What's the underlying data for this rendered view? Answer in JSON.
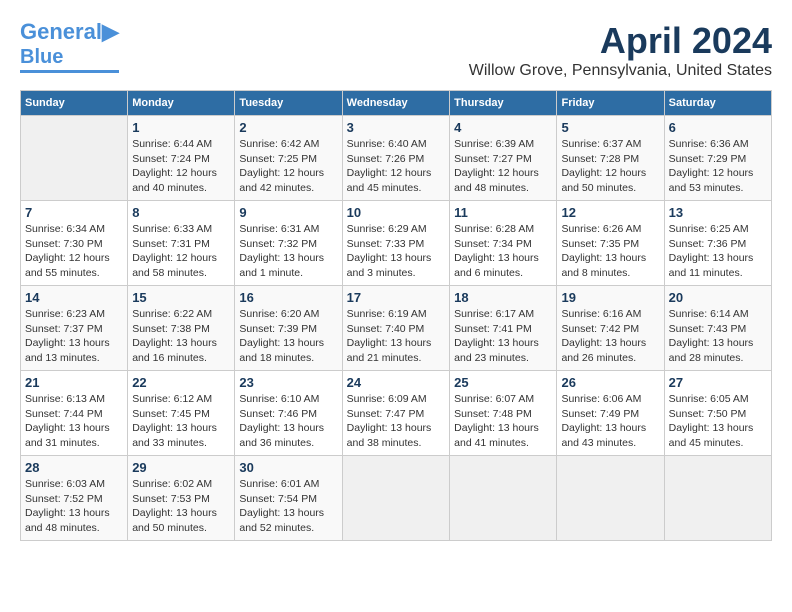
{
  "header": {
    "logo_line1": "General",
    "logo_line2": "Blue",
    "month_title": "April 2024",
    "location": "Willow Grove, Pennsylvania, United States"
  },
  "calendar": {
    "weekdays": [
      "Sunday",
      "Monday",
      "Tuesday",
      "Wednesday",
      "Thursday",
      "Friday",
      "Saturday"
    ],
    "weeks": [
      [
        {
          "day": "",
          "info": ""
        },
        {
          "day": "1",
          "info": "Sunrise: 6:44 AM\nSunset: 7:24 PM\nDaylight: 12 hours\nand 40 minutes."
        },
        {
          "day": "2",
          "info": "Sunrise: 6:42 AM\nSunset: 7:25 PM\nDaylight: 12 hours\nand 42 minutes."
        },
        {
          "day": "3",
          "info": "Sunrise: 6:40 AM\nSunset: 7:26 PM\nDaylight: 12 hours\nand 45 minutes."
        },
        {
          "day": "4",
          "info": "Sunrise: 6:39 AM\nSunset: 7:27 PM\nDaylight: 12 hours\nand 48 minutes."
        },
        {
          "day": "5",
          "info": "Sunrise: 6:37 AM\nSunset: 7:28 PM\nDaylight: 12 hours\nand 50 minutes."
        },
        {
          "day": "6",
          "info": "Sunrise: 6:36 AM\nSunset: 7:29 PM\nDaylight: 12 hours\nand 53 minutes."
        }
      ],
      [
        {
          "day": "7",
          "info": "Sunrise: 6:34 AM\nSunset: 7:30 PM\nDaylight: 12 hours\nand 55 minutes."
        },
        {
          "day": "8",
          "info": "Sunrise: 6:33 AM\nSunset: 7:31 PM\nDaylight: 12 hours\nand 58 minutes."
        },
        {
          "day": "9",
          "info": "Sunrise: 6:31 AM\nSunset: 7:32 PM\nDaylight: 13 hours\nand 1 minute."
        },
        {
          "day": "10",
          "info": "Sunrise: 6:29 AM\nSunset: 7:33 PM\nDaylight: 13 hours\nand 3 minutes."
        },
        {
          "day": "11",
          "info": "Sunrise: 6:28 AM\nSunset: 7:34 PM\nDaylight: 13 hours\nand 6 minutes."
        },
        {
          "day": "12",
          "info": "Sunrise: 6:26 AM\nSunset: 7:35 PM\nDaylight: 13 hours\nand 8 minutes."
        },
        {
          "day": "13",
          "info": "Sunrise: 6:25 AM\nSunset: 7:36 PM\nDaylight: 13 hours\nand 11 minutes."
        }
      ],
      [
        {
          "day": "14",
          "info": "Sunrise: 6:23 AM\nSunset: 7:37 PM\nDaylight: 13 hours\nand 13 minutes."
        },
        {
          "day": "15",
          "info": "Sunrise: 6:22 AM\nSunset: 7:38 PM\nDaylight: 13 hours\nand 16 minutes."
        },
        {
          "day": "16",
          "info": "Sunrise: 6:20 AM\nSunset: 7:39 PM\nDaylight: 13 hours\nand 18 minutes."
        },
        {
          "day": "17",
          "info": "Sunrise: 6:19 AM\nSunset: 7:40 PM\nDaylight: 13 hours\nand 21 minutes."
        },
        {
          "day": "18",
          "info": "Sunrise: 6:17 AM\nSunset: 7:41 PM\nDaylight: 13 hours\nand 23 minutes."
        },
        {
          "day": "19",
          "info": "Sunrise: 6:16 AM\nSunset: 7:42 PM\nDaylight: 13 hours\nand 26 minutes."
        },
        {
          "day": "20",
          "info": "Sunrise: 6:14 AM\nSunset: 7:43 PM\nDaylight: 13 hours\nand 28 minutes."
        }
      ],
      [
        {
          "day": "21",
          "info": "Sunrise: 6:13 AM\nSunset: 7:44 PM\nDaylight: 13 hours\nand 31 minutes."
        },
        {
          "day": "22",
          "info": "Sunrise: 6:12 AM\nSunset: 7:45 PM\nDaylight: 13 hours\nand 33 minutes."
        },
        {
          "day": "23",
          "info": "Sunrise: 6:10 AM\nSunset: 7:46 PM\nDaylight: 13 hours\nand 36 minutes."
        },
        {
          "day": "24",
          "info": "Sunrise: 6:09 AM\nSunset: 7:47 PM\nDaylight: 13 hours\nand 38 minutes."
        },
        {
          "day": "25",
          "info": "Sunrise: 6:07 AM\nSunset: 7:48 PM\nDaylight: 13 hours\nand 41 minutes."
        },
        {
          "day": "26",
          "info": "Sunrise: 6:06 AM\nSunset: 7:49 PM\nDaylight: 13 hours\nand 43 minutes."
        },
        {
          "day": "27",
          "info": "Sunrise: 6:05 AM\nSunset: 7:50 PM\nDaylight: 13 hours\nand 45 minutes."
        }
      ],
      [
        {
          "day": "28",
          "info": "Sunrise: 6:03 AM\nSunset: 7:52 PM\nDaylight: 13 hours\nand 48 minutes."
        },
        {
          "day": "29",
          "info": "Sunrise: 6:02 AM\nSunset: 7:53 PM\nDaylight: 13 hours\nand 50 minutes."
        },
        {
          "day": "30",
          "info": "Sunrise: 6:01 AM\nSunset: 7:54 PM\nDaylight: 13 hours\nand 52 minutes."
        },
        {
          "day": "",
          "info": ""
        },
        {
          "day": "",
          "info": ""
        },
        {
          "day": "",
          "info": ""
        },
        {
          "day": "",
          "info": ""
        }
      ]
    ]
  }
}
